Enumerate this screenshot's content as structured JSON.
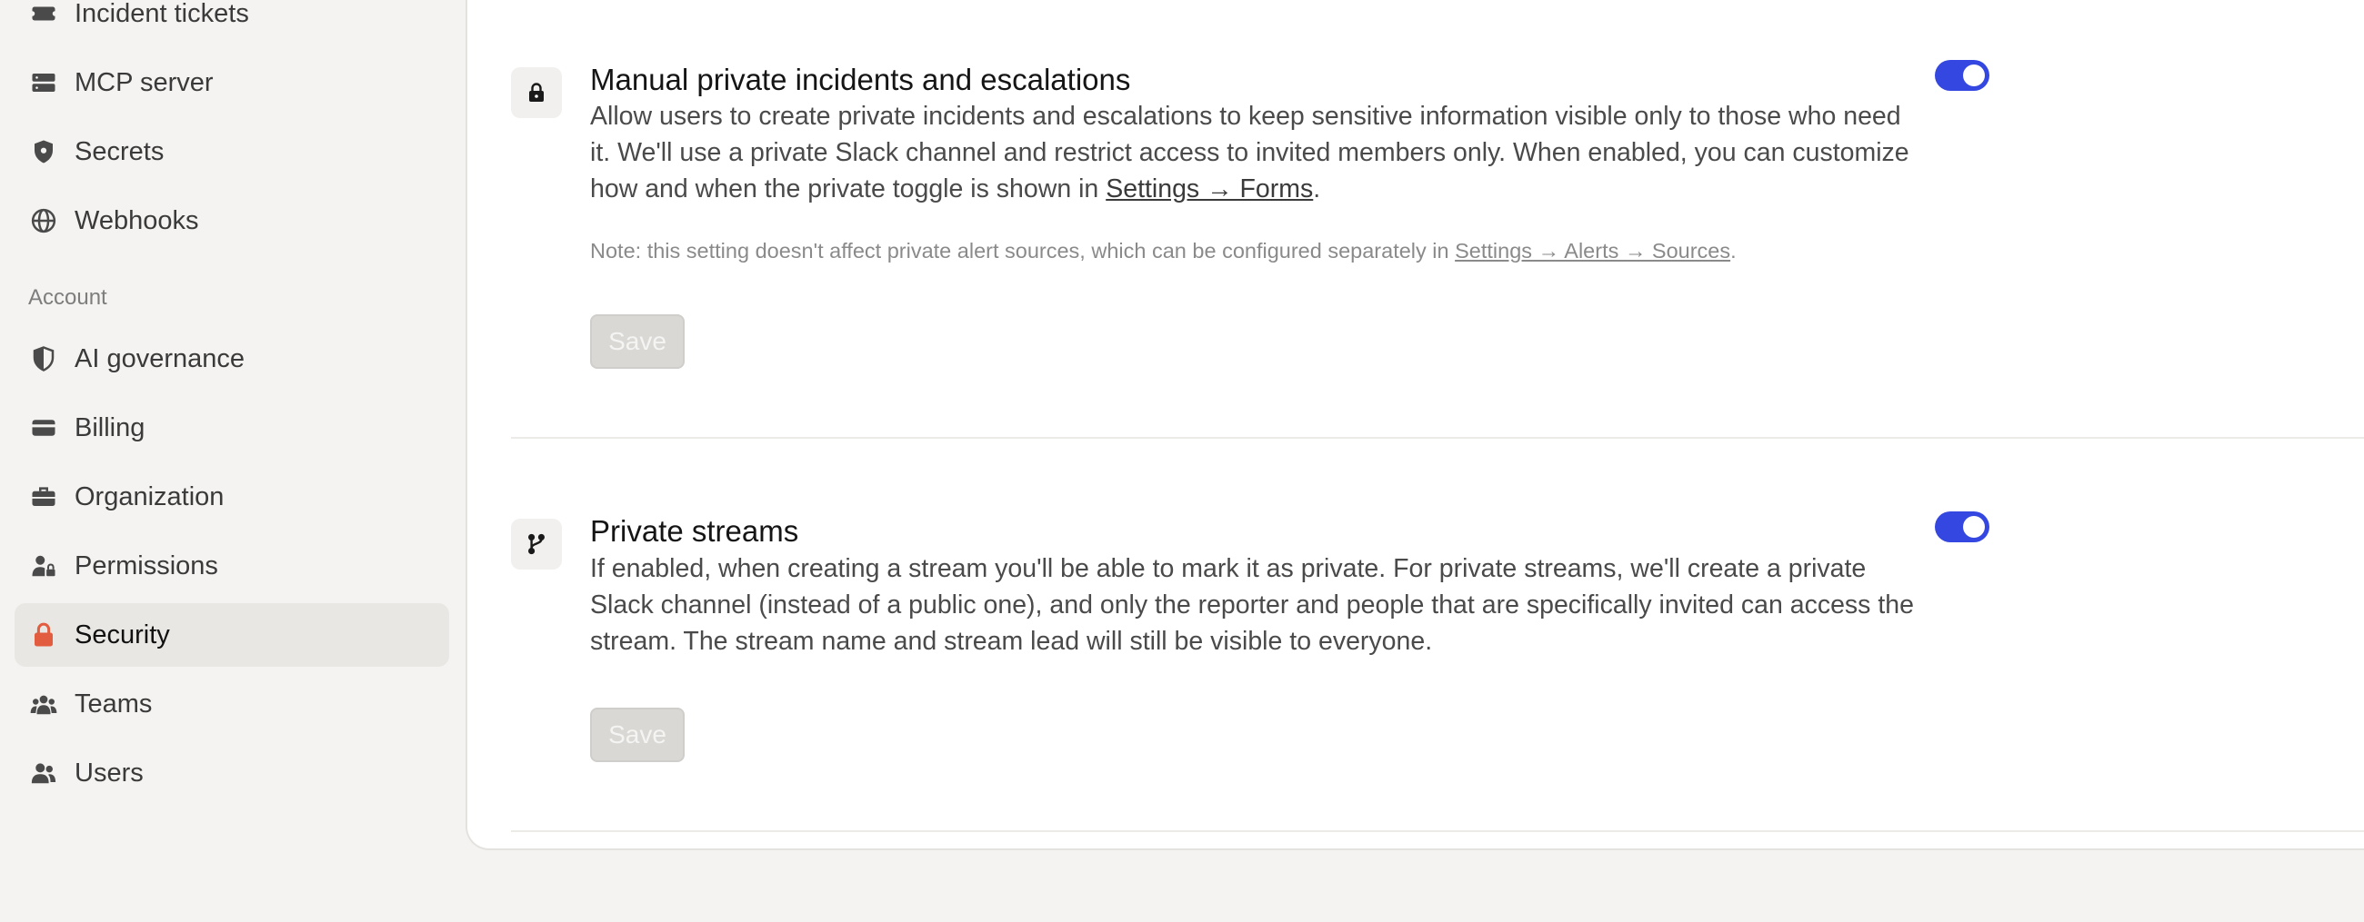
{
  "sidebar": {
    "items_top": [
      {
        "label": "Incident tickets",
        "icon": "ticket-icon"
      },
      {
        "label": "MCP server",
        "icon": "server-icon"
      },
      {
        "label": "Secrets",
        "icon": "shield-icon"
      },
      {
        "label": "Webhooks",
        "icon": "globe-icon"
      }
    ],
    "section_account": "Account",
    "items_account": [
      {
        "label": "AI governance",
        "icon": "half-shield-icon"
      },
      {
        "label": "Billing",
        "icon": "credit-card-icon"
      },
      {
        "label": "Organization",
        "icon": "briefcase-icon"
      },
      {
        "label": "Permissions",
        "icon": "user-lock-icon"
      },
      {
        "label": "Security",
        "icon": "lock-icon",
        "active": true
      },
      {
        "label": "Teams",
        "icon": "users-group-icon"
      },
      {
        "label": "Users",
        "icon": "users-icon"
      }
    ]
  },
  "settings": [
    {
      "title": "Manual private incidents and escalations",
      "description": "Allow users to create private incidents and escalations to keep sensitive information visible only to those who need it. We'll use a private Slack channel and restrict access to invited members only. When enabled, you can customize how and when the private toggle is shown in ",
      "link": "Settings → Forms",
      "after_link": ".",
      "note_prefix": "Note: this setting doesn't affect private alert sources, which can be configured separately in ",
      "note_link": "Settings → Alerts → Sources",
      "note_suffix": ".",
      "save_label": "Save",
      "enabled": true
    },
    {
      "title": "Private streams",
      "description": "If enabled, when creating a stream you'll be able to mark it as private. For private streams, we'll create a private Slack channel (instead of a public one), and only the reporter and people that are specifically invited can access the stream. The stream name and stream lead will still be visible to everyone.",
      "save_label": "Save",
      "enabled": true
    }
  ],
  "colors": {
    "accent": "#3447e0",
    "active_icon": "#e25c3f",
    "icon": "#4a4a4a"
  }
}
